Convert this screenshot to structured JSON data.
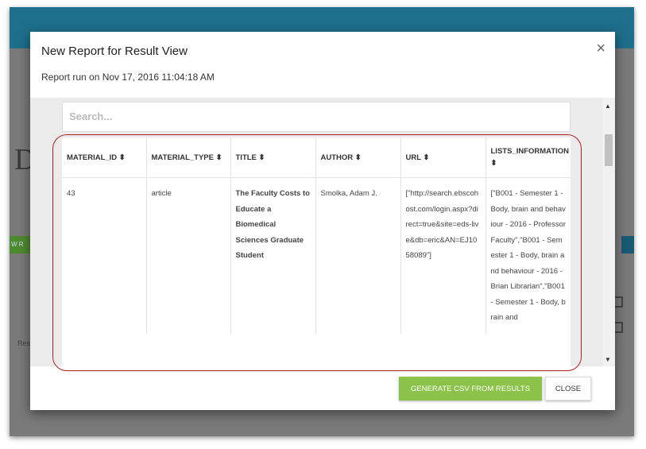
{
  "modal": {
    "title": "New Report for Result View",
    "subtitle": "Report run on Nov 17, 2016 11:04:18 AM",
    "close_icon": "×"
  },
  "search": {
    "placeholder": "Search..."
  },
  "table": {
    "headers": [
      "MATERIAL_ID ⬍",
      "MATERIAL_TYPE ⬍",
      "TITLE ⬍",
      "AUTHOR ⬍",
      "URL ⬍",
      "LISTS_INFORMATION ⬍"
    ],
    "rows": [
      {
        "material_id": "43",
        "material_type": "article",
        "title": "The Faculty Costs to Educate a Biomedical Sciences Graduate Student",
        "author": "Smolka, Adam J.",
        "url": "[\"http://search.ebscohost.com/login.aspx?direct=true&site=eds-live&db=eric&AN=EJ1058089\"]",
        "lists_information": "[\"B001 - Semester 1 - Body, brain and behaviour - 2016 - Professor Faculty\",\"B001 - Semester 1 - Body, brain and behaviour - 2016 - Brian Librarian\",\"B001 - Semester 1 - Body, brain and"
      }
    ]
  },
  "buttons": {
    "generate": "GENERATE CSV FROM RESULTS",
    "close": "CLOSE"
  },
  "scrollbar": {
    "up": "▲",
    "down": "▼"
  },
  "background": {
    "partial_heading": "DC",
    "partial_label": "Res"
  },
  "colors": {
    "green_button": "#8bc34a",
    "topbar": "#1e6f8c",
    "highlight": "#b02020"
  }
}
